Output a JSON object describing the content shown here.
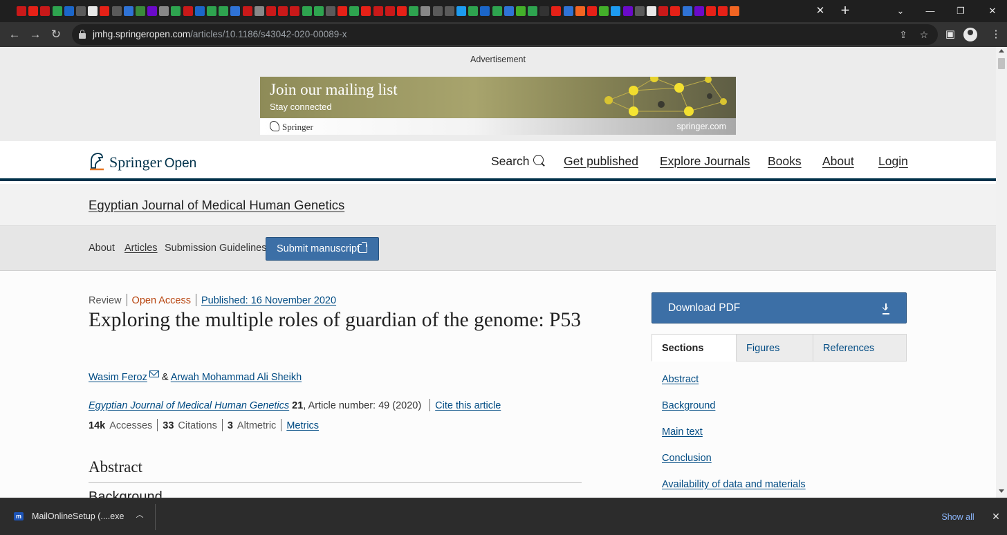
{
  "browser": {
    "tab_favicons": [
      "#c91919",
      "#e62117",
      "#c91919",
      "#2ea44f",
      "#1b66c9",
      "#5a5a5a",
      "#e8e8e8",
      "#e62117",
      "#5a5a5a",
      "#2f73d6",
      "#3a8a3a",
      "#6b0ac9",
      "#888888",
      "#2ea44f",
      "#c91919",
      "#1b66c9",
      "#2ea44f",
      "#2ea44f",
      "#2f73d6",
      "#c91919",
      "#888888",
      "#c91919",
      "#c91919",
      "#c91919",
      "#2ea44f",
      "#2ea44f",
      "#5a5a5a",
      "#e62117",
      "#2ea44f",
      "#e62117",
      "#c91919",
      "#c91919",
      "#e62117",
      "#2ea44f",
      "#888888",
      "#5a5a5a",
      "#5a5a5a",
      "#1d9bf0",
      "#2ea44f",
      "#1b66c9",
      "#2ea44f",
      "#2f73d6",
      "#43b02a",
      "#2ea44f",
      "#333333",
      "#e62117",
      "#2f73d6",
      "#f26522",
      "#e62117",
      "#43b02a",
      "#1d9bf0",
      "#6b0ac9",
      "#5a5a5a",
      "#e8e8e8",
      "#c91919",
      "#e62117",
      "#2f73d6",
      "#6b0ac9",
      "#e62117",
      "#e62117",
      "#f26522"
    ],
    "tab_close_icon": "close-icon",
    "new_tab_icon": "plus-icon",
    "window_controls": {
      "dropdown": "⌄",
      "minimize": "—",
      "maximize": "❐",
      "close": "✕"
    },
    "url_domain": "jmhg.springeropen.com",
    "url_path": "/articles/10.1186/s43042-020-00089-x",
    "share_icon": "⇪",
    "star_icon": "☆",
    "sidebar_icon": "▣",
    "menu_icon": "⋮"
  },
  "ad": {
    "label": "Advertisement",
    "title": "Join our mailing list",
    "subtitle": "Stay connected",
    "brand": "Springer",
    "domain": "springer.com"
  },
  "header": {
    "logo_springer": "Springer",
    "logo_open": "Open",
    "nav": {
      "search": "Search",
      "get_published": "Get published",
      "explore": "Explore Journals",
      "books": "Books",
      "about": "About",
      "login": "Login"
    },
    "accent_color": "#01324b"
  },
  "journal": {
    "title": "Egyptian Journal of Medical Human Genetics"
  },
  "subnav": {
    "about": "About",
    "articles": "Articles",
    "guidelines": "Submission Guidelines",
    "submit": "Submit manuscript"
  },
  "article": {
    "type": "Review",
    "access": "Open Access",
    "published": "Published: 16 November 2020",
    "title": "Exploring the multiple roles of guardian of the genome: P53",
    "author1": "Wasim Feroz",
    "author_sep": "&",
    "author2": "Arwah Mohammad Ali Sheikh",
    "journal_name": "Egyptian Journal of Medical Human Genetics",
    "volume": "21",
    "article_number": ", Article number: 49 (2020)",
    "cite": "Cite this article",
    "accesses_count": "14k",
    "accesses_label": "Accesses",
    "citations_count": "33",
    "citations_label": "Citations",
    "altmetric_count": "3",
    "altmetric_label": "Altmetric",
    "metrics_link": "Metrics",
    "abstract_heading": "Abstract",
    "background_heading": "Background"
  },
  "sidebar": {
    "download": "Download PDF",
    "tabs": [
      "Sections",
      "Figures",
      "References"
    ],
    "toc": [
      "Abstract",
      "Background",
      "Main text",
      "Conclusion",
      "Availability of data and materials"
    ]
  },
  "downloads": {
    "file_name": "MailOnlineSetup (....exe",
    "show_all": "Show all"
  }
}
